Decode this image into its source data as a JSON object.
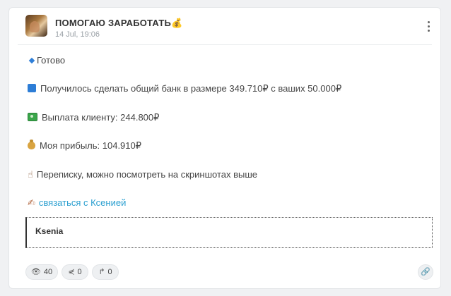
{
  "post": {
    "channel_title": "ПОМОГАЮ ЗАРАБОТАТЬ💰",
    "date": "14 Jul, 19:06",
    "lines": {
      "ready": "Готово",
      "bank": "Получилось сделать общий банк в размере 349.710₽ с ваших 50.000₽",
      "payout": "Выплата клиенту: 244.800₽",
      "profit": "Моя прибыль: 104.910₽",
      "screenshots": "Переписку, можно посмотреть на скриншотах выше",
      "contact_link": "связаться с Ксенией"
    },
    "quote_author": "Ksenia"
  },
  "footer": {
    "views": "40",
    "shares": "0",
    "forwards": "0"
  },
  "icons": [
    "avatar",
    "more-vertical-icon",
    "blue-diamond-icon",
    "blue-square-icon",
    "money-icon",
    "money-bag-icon",
    "pointing-hand-icon",
    "writing-hand-icon",
    "eye-icon",
    "share-icon",
    "forward-icon",
    "link-icon"
  ]
}
